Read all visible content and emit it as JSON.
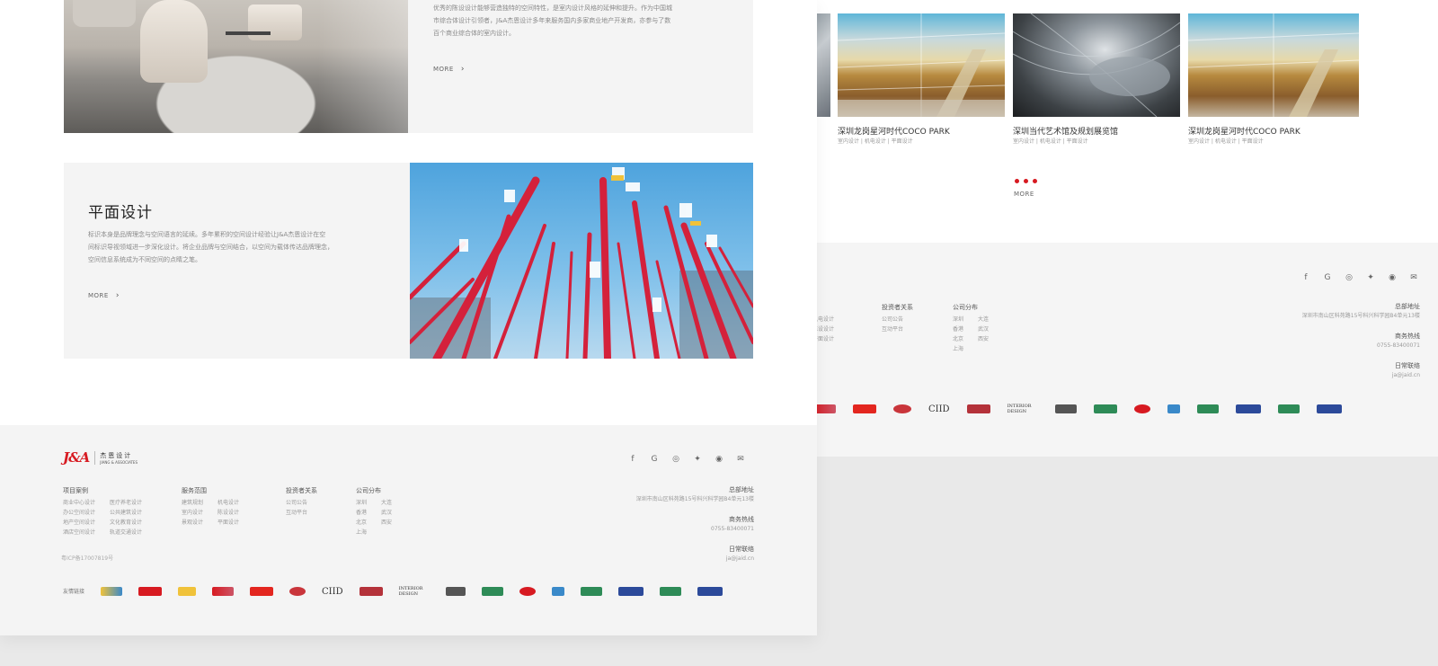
{
  "left": {
    "intro_lines": [
      "优秀的陈设设计能够营造独特的空间特性，是室内设计风格的延伸和提升。作为中国城",
      "市综合体设计引领者，J&A杰恩设计多年来服务国内多家商业地产开发商，亦参与了数",
      "百个商业综合体的室内设计。"
    ],
    "intro_more": "MORE",
    "graphic": {
      "title": "平面设计",
      "lines": [
        "标识本身是品牌理念与空间语言的延续。多年累积的空间设计经验让J&A杰恩设计在空",
        "间标识导视领域进一步深化设计。将企业品牌与空间结合，以空间为载体传达品牌理念，",
        "空间信息系统成为不同空间的点睛之笔。"
      ],
      "more": "MORE"
    },
    "footer": {
      "brand": "J&A",
      "brand_cn": "杰恩设计",
      "brand_en": "JIANG & ASSOCIATES",
      "cols": [
        {
          "title": "项目案例",
          "items": [
            "商业中心设计",
            "办公空间设计",
            "地产空间设计",
            "酒店空间设计",
            "医疗养老设计",
            "公共建筑设计",
            "文化教育设计",
            "轨道交通设计"
          ]
        },
        {
          "title": "服务范围",
          "items": [
            "建筑规划",
            "室内设计",
            "景观设计",
            "机电设计",
            "陈设设计",
            "平面设计"
          ]
        },
        {
          "title": "投资者关系",
          "items": [
            "公司公告",
            "互动平台"
          ]
        },
        {
          "title": "公司分布",
          "items": [
            "深圳",
            "大连",
            "香港",
            "武汉",
            "北京",
            "西安",
            "上海"
          ]
        }
      ],
      "contact": [
        {
          "title": "总部地址",
          "value": "深圳市南山区科苑路15号科兴科学园B4单元13楼"
        },
        {
          "title": "商务热线",
          "value": "0755-83400071"
        },
        {
          "title": "日常联络",
          "value": "ja@jaid.cn"
        }
      ],
      "icp": "粤ICP备17007819号",
      "partners_label": "友情链接",
      "socials": [
        "f",
        "G",
        "◎",
        "✦",
        "◉",
        "✉"
      ]
    }
  },
  "right": {
    "projects": [
      {
        "name": "深圳龙岗星河时代COCO PARK",
        "tags": "室内设计 | 机电设计 | 平面设计"
      },
      {
        "name": "深圳当代艺术馆及规划展览馆",
        "tags": "室内设计 | 机电设计 | 平面设计"
      },
      {
        "name": "深圳龙岗星河时代COCO PARK",
        "tags": "室内设计 | 机电设计 | 平面设计"
      }
    ],
    "more": "MORE",
    "footer": {
      "col_service": [
        "机电设计",
        "陈设设计",
        "平面设计"
      ],
      "investor_title": "投资者关系",
      "investor_items": [
        "公司公告",
        "互动平台"
      ],
      "branch_title": "公司分布",
      "branch_items": [
        "深圳",
        "大连",
        "香港",
        "武汉",
        "北京",
        "西安",
        "上海"
      ],
      "contact": [
        {
          "title": "总部地址",
          "value": "深圳市南山区科苑路15号科兴科学园B4单元13楼"
        },
        {
          "title": "商务热线",
          "value": "0755-83400071"
        },
        {
          "title": "日常联络",
          "value": "ja@jaid.cn"
        }
      ],
      "socials": [
        "f",
        "G",
        "◎",
        "✦",
        "◉",
        "✉"
      ]
    }
  },
  "partner_logos": [
    "CIID",
    "INTERIOR DESIGN"
  ],
  "colors": {
    "brand_red": "#d71a21",
    "accent_blue": "#2c4a9a",
    "accent_green": "#2e8b57"
  }
}
